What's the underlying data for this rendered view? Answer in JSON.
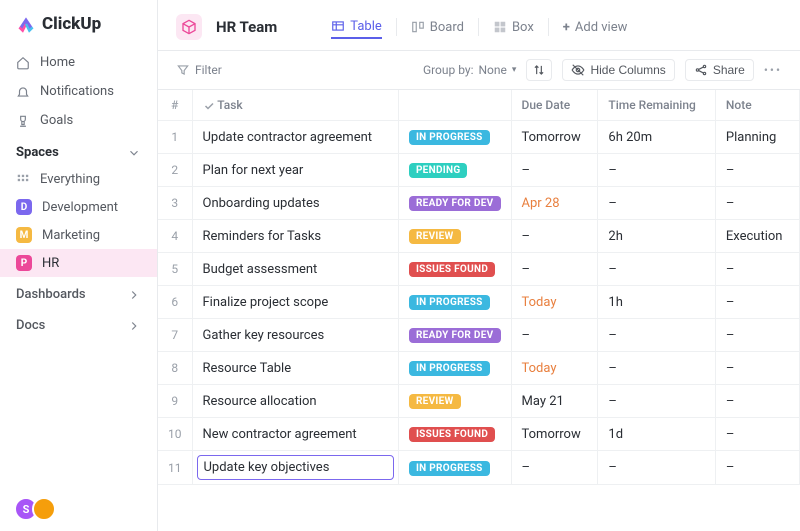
{
  "brand": {
    "name": "ClickUp"
  },
  "nav": {
    "home": "Home",
    "notifications": "Notifications",
    "goals": "Goals"
  },
  "sidebar": {
    "spaces_label": "Spaces",
    "everything": "Everything",
    "spaces": [
      {
        "initial": "D",
        "label": "Development",
        "color": "#7b68ee"
      },
      {
        "initial": "M",
        "label": "Marketing",
        "color": "#f5b942"
      },
      {
        "initial": "P",
        "label": "HR",
        "color": "#ec4899",
        "active": true
      }
    ],
    "dashboards": "Dashboards",
    "docs": "Docs"
  },
  "header": {
    "team_name": "HR Team",
    "views": {
      "table": "Table",
      "board": "Board",
      "box": "Box",
      "add_view": "Add view"
    }
  },
  "toolbar": {
    "filter": "Filter",
    "group_by_label": "Group by:",
    "group_by_value": "None",
    "hide_columns": "Hide Columns",
    "share": "Share"
  },
  "table": {
    "columns": {
      "index": "#",
      "task": "Task",
      "status": "",
      "due": "Due Date",
      "time": "Time Remaining",
      "note": "Note"
    },
    "status_colors": {
      "IN PROGRESS": "#3bb8e0",
      "PENDING": "#2ecfc0",
      "READY FOR DEV": "#9b6dd7",
      "REVIEW": "#f5b942",
      "ISSUES FOUND": "#e04f4f"
    },
    "rows": [
      {
        "n": "1",
        "task": "Update contractor agreement",
        "status": "IN PROGRESS",
        "due": "Tomorrow",
        "due_warn": false,
        "time": "6h 20m",
        "note": "Planning"
      },
      {
        "n": "2",
        "task": "Plan for next year",
        "status": "PENDING",
        "due": "–",
        "due_warn": false,
        "time": "–",
        "note": "–"
      },
      {
        "n": "3",
        "task": "Onboarding updates",
        "status": "READY FOR DEV",
        "due": "Apr 28",
        "due_warn": true,
        "time": "–",
        "note": "–"
      },
      {
        "n": "4",
        "task": "Reminders for Tasks",
        "status": "REVIEW",
        "due": "–",
        "due_warn": false,
        "time": "2h",
        "note": "Execution"
      },
      {
        "n": "5",
        "task": "Budget assessment",
        "status": "ISSUES FOUND",
        "due": "–",
        "due_warn": false,
        "time": "–",
        "note": "–"
      },
      {
        "n": "6",
        "task": "Finalize project scope",
        "status": "IN PROGRESS",
        "due": "Today",
        "due_warn": true,
        "time": "1h",
        "note": "–"
      },
      {
        "n": "7",
        "task": "Gather key resources",
        "status": "READY FOR DEV",
        "due": "–",
        "due_warn": false,
        "time": "–",
        "note": "–"
      },
      {
        "n": "8",
        "task": "Resource Table",
        "status": "IN PROGRESS",
        "due": "Today",
        "due_warn": true,
        "time": "–",
        "note": "–"
      },
      {
        "n": "9",
        "task": "Resource allocation",
        "status": "REVIEW",
        "due": "May 21",
        "due_warn": false,
        "time": "–",
        "note": "–"
      },
      {
        "n": "10",
        "task": "New contractor agreement",
        "status": "ISSUES FOUND",
        "due": "Tomorrow",
        "due_warn": false,
        "time": "1d",
        "note": "–"
      },
      {
        "n": "11",
        "task": "Update key objectives",
        "status": "IN PROGRESS",
        "due": "–",
        "due_warn": false,
        "time": "–",
        "note": "–",
        "editing": true
      }
    ]
  },
  "avatars": [
    {
      "initial": "S",
      "color": "#a855f7"
    },
    {
      "initial": "",
      "color": "#f59e0b"
    }
  ]
}
